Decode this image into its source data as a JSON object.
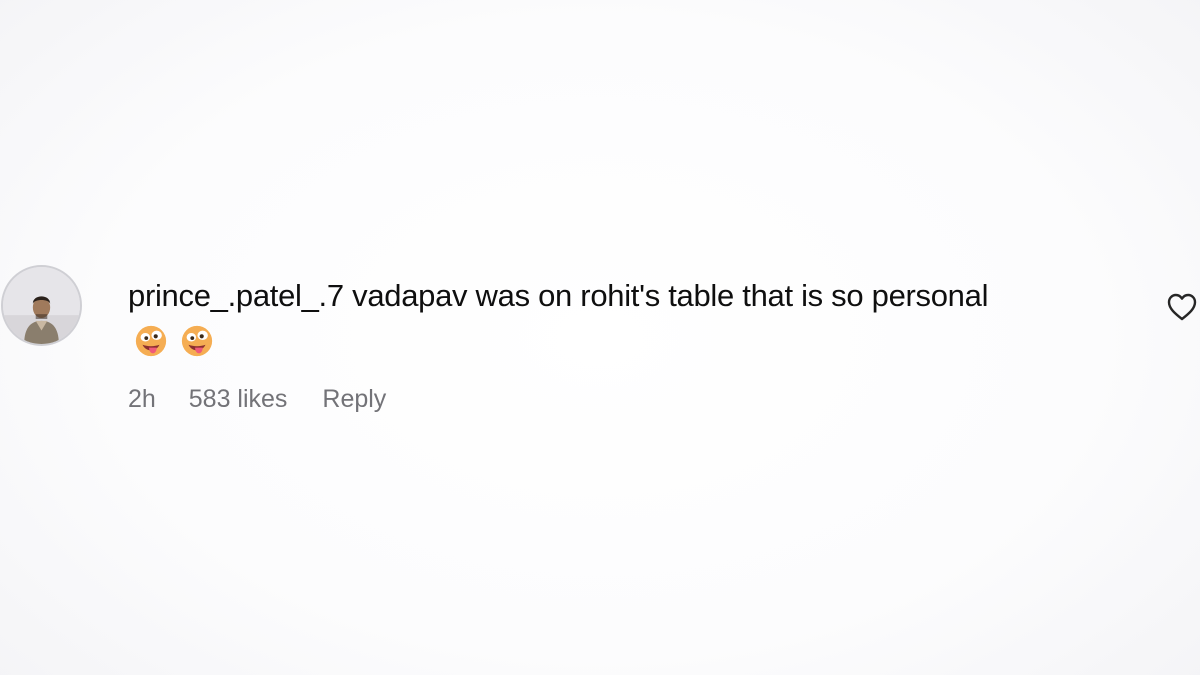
{
  "comment": {
    "username": "prince_.patel_.7",
    "text": "vadapav was on rohit's table that is so personal",
    "emojis": [
      "drooling-face-emoji",
      "drooling-face-emoji"
    ],
    "time": "2h",
    "likes": "583 likes",
    "reply_label": "Reply",
    "like_icon": "heart-outline-icon",
    "avatar": "user-avatar-photo"
  },
  "colors": {
    "text": "#0f0f0f",
    "meta": "#737378",
    "icon": "#262626"
  }
}
